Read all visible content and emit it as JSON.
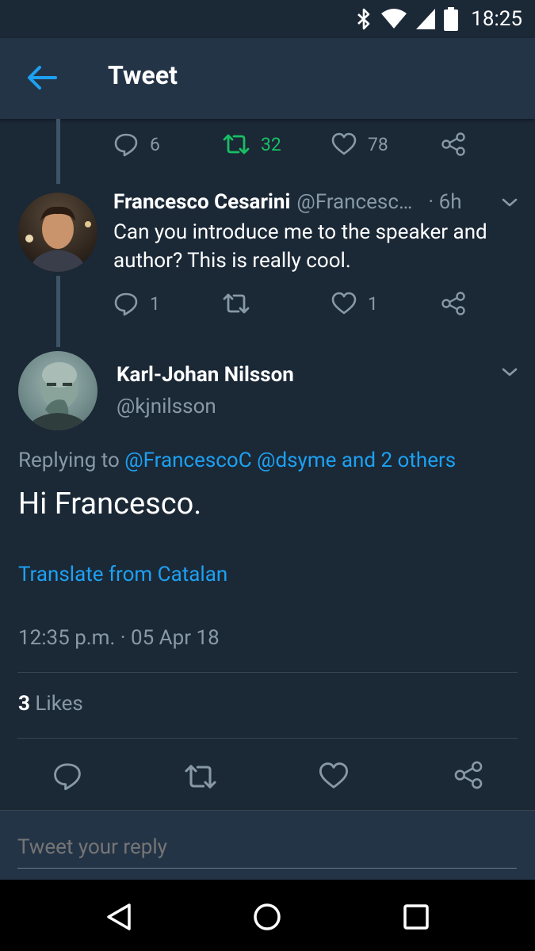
{
  "status_bar": {
    "time": "18:25"
  },
  "app_bar": {
    "title": "Tweet"
  },
  "parent_tweet_actions": {
    "replies": "6",
    "retweets": "32",
    "likes": "78"
  },
  "reply_tweet": {
    "name": "Francesco Cesarini",
    "handle": "@Francesc…",
    "time": "· 6h",
    "text": "Can you introduce me to the speaker and author? This is really cool.",
    "actions": {
      "replies": "1",
      "likes": "1"
    }
  },
  "main_tweet": {
    "name": "Karl-Johan Nilsson",
    "handle": "@kjnilsson",
    "replying_prefix": "Replying to",
    "replying_mentions": "@FrancescoC @dsyme and 2 others",
    "text": "Hi Francesco.",
    "translate": "Translate from Catalan",
    "timestamp": "12:35 p.m. · 05 Apr 18",
    "likes_count": "3",
    "likes_label": "Likes"
  },
  "reply_box": {
    "placeholder": "Tweet your reply"
  },
  "colors": {
    "background": "#1b2836",
    "app_bar": "#243447",
    "accent": "#1da1f2",
    "retweet_active": "#17bf63",
    "muted": "#8899a6"
  }
}
